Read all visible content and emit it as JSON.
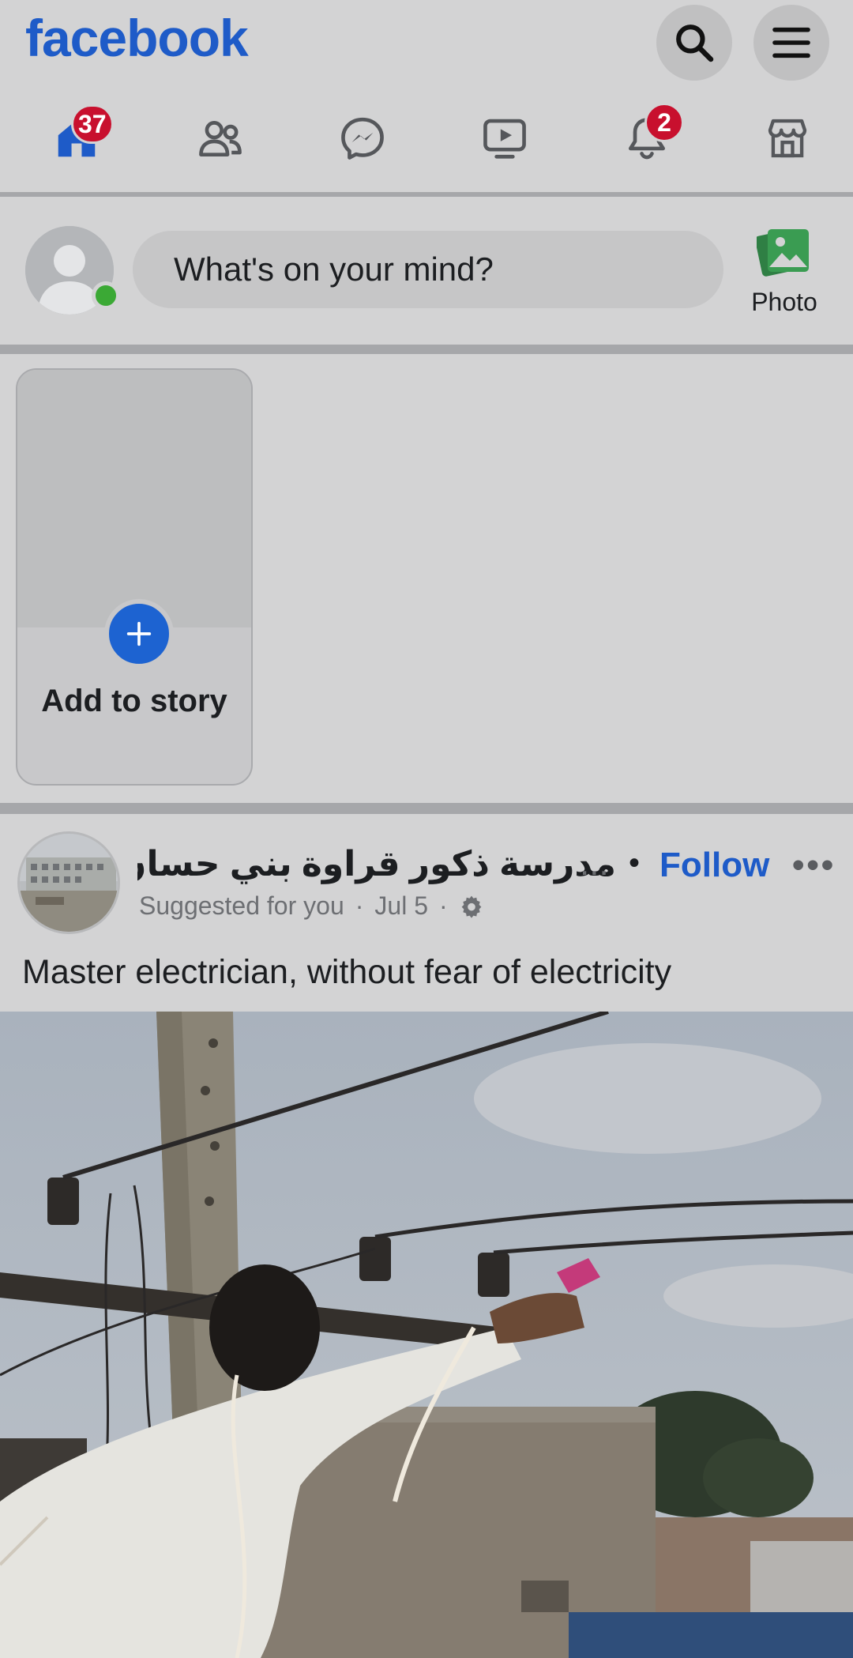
{
  "header": {
    "brand": "facebook",
    "search_icon": "search-icon",
    "menu_icon": "menu-icon"
  },
  "nav": {
    "tabs": [
      {
        "name": "home",
        "icon": "home-icon",
        "badge": "37"
      },
      {
        "name": "friends",
        "icon": "friends-icon",
        "badge": ""
      },
      {
        "name": "messenger",
        "icon": "messenger-icon",
        "badge": ""
      },
      {
        "name": "watch",
        "icon": "video-icon",
        "badge": ""
      },
      {
        "name": "notifications",
        "icon": "bell-icon",
        "badge": "2"
      },
      {
        "name": "marketplace",
        "icon": "marketplace-icon",
        "badge": ""
      }
    ]
  },
  "composer": {
    "placeholder": "What's on your mind?",
    "photo_label": "Photo"
  },
  "stories": {
    "add_label": "Add to story"
  },
  "post": {
    "page_name": "مدرسة ذكور قراوة بني حسان ا",
    "ellipsis": "...",
    "separator": "•",
    "follow_label": "Follow",
    "more_label": "•••",
    "suggested": "Suggested for you",
    "meta_sep": "·",
    "date": "Jul 5",
    "caption": "Master electrician, without fear of electricity"
  },
  "colors": {
    "brand_blue": "#1e5bc8",
    "badge_red": "#c8102e",
    "online_green": "#3ba935",
    "photo_green": "#3a9c52"
  }
}
